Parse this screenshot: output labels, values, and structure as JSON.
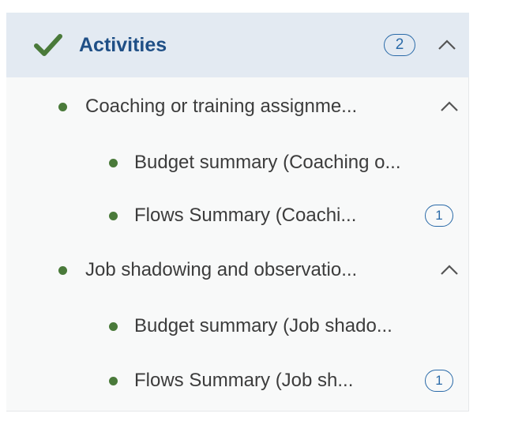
{
  "section": {
    "title": "Activities",
    "count": "2",
    "check_icon": "checkmark-icon",
    "collapse_icon": "chevron-up-icon",
    "status_color": "#4a7a3a",
    "accent_color": "#1f4f86"
  },
  "items": [
    {
      "label": "Coaching or training assignme...",
      "children": [
        {
          "label": "Budget summary (Coaching o..."
        },
        {
          "label": "Flows Summary (Coachi...",
          "count": "1"
        }
      ]
    },
    {
      "label": "Job shadowing and observatio...",
      "children": [
        {
          "label": "Budget summary (Job shado..."
        },
        {
          "label": "Flows Summary (Job sh...",
          "count": "1"
        }
      ]
    }
  ]
}
